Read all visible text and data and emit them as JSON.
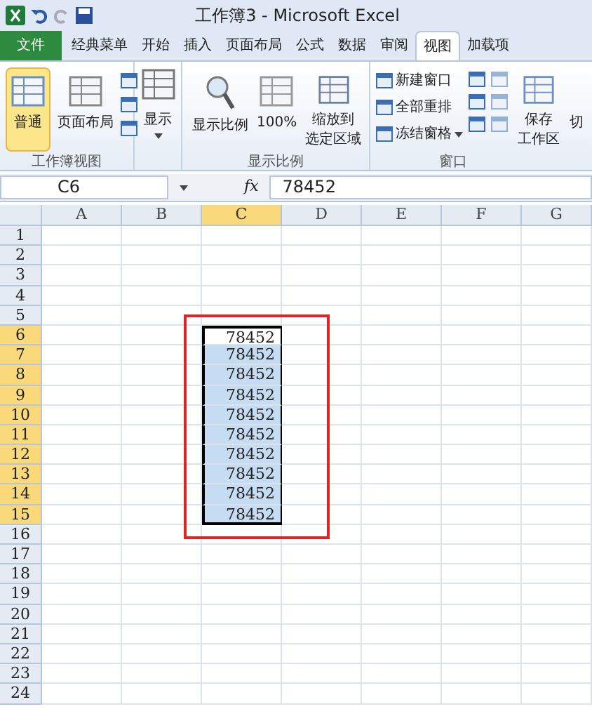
{
  "window": {
    "title": "工作簿3 - Microsoft Excel"
  },
  "tabs": [
    {
      "label": "文件",
      "kind": "file",
      "selected": false
    },
    {
      "label": "经典菜单",
      "kind": "tab",
      "selected": false
    },
    {
      "label": "开始",
      "kind": "tab",
      "selected": false
    },
    {
      "label": "插入",
      "kind": "tab",
      "selected": false
    },
    {
      "label": "页面布局",
      "kind": "tab",
      "selected": false
    },
    {
      "label": "公式",
      "kind": "tab",
      "selected": false
    },
    {
      "label": "数据",
      "kind": "tab",
      "selected": false
    },
    {
      "label": "审阅",
      "kind": "tab",
      "selected": false
    },
    {
      "label": "视图",
      "kind": "tab",
      "selected": true
    },
    {
      "label": "加载项",
      "kind": "tab",
      "selected": false
    }
  ],
  "ribbon": {
    "workbook_views": {
      "label": "工作簿视图",
      "normal": {
        "label": "普通",
        "selected": true
      },
      "page_layout": {
        "label": "页面布局",
        "selected": false
      }
    },
    "show": {
      "label": "显示"
    },
    "zoom": {
      "label": "显示比例",
      "zoom": "显示比例",
      "hundred": "100%",
      "zoom_selection": [
        "缩放到",
        "选定区域"
      ]
    },
    "window": {
      "label": "窗口",
      "new_window": "新建窗口",
      "arrange_all": "全部重排",
      "freeze_panes": "冻结窗格",
      "save_workspace": [
        "保存",
        "工作区"
      ],
      "switch_cut": "切"
    }
  },
  "formula_bar": {
    "name_box": "C6",
    "fx": "fx",
    "value": "78452"
  },
  "columns": [
    {
      "label": "A",
      "selected": false
    },
    {
      "label": "B",
      "selected": false
    },
    {
      "label": "C",
      "selected": true
    },
    {
      "label": "D",
      "selected": false
    },
    {
      "label": "E",
      "selected": false
    },
    {
      "label": "F",
      "selected": false
    },
    {
      "label": "G",
      "selected": false
    }
  ],
  "rows": [
    {
      "label": "1",
      "selected": false
    },
    {
      "label": "2",
      "selected": false
    },
    {
      "label": "3",
      "selected": false
    },
    {
      "label": "4",
      "selected": false
    },
    {
      "label": "5",
      "selected": false
    },
    {
      "label": "6",
      "selected": true,
      "active": true,
      "value": "78452"
    },
    {
      "label": "7",
      "selected": true,
      "active": false,
      "value": "78452"
    },
    {
      "label": "8",
      "selected": true,
      "active": false,
      "value": "78452"
    },
    {
      "label": "9",
      "selected": true,
      "active": false,
      "value": "78452"
    },
    {
      "label": "10",
      "selected": true,
      "active": false,
      "value": "78452"
    },
    {
      "label": "11",
      "selected": true,
      "active": false,
      "value": "78452"
    },
    {
      "label": "12",
      "selected": true,
      "active": false,
      "value": "78452"
    },
    {
      "label": "13",
      "selected": true,
      "active": false,
      "value": "78452"
    },
    {
      "label": "14",
      "selected": true,
      "active": false,
      "value": "78452"
    },
    {
      "label": "15",
      "selected": true,
      "active": false,
      "value": "78452"
    },
    {
      "label": "16",
      "selected": false
    },
    {
      "label": "17",
      "selected": false
    },
    {
      "label": "18",
      "selected": false
    },
    {
      "label": "19",
      "selected": false
    },
    {
      "label": "20",
      "selected": false
    },
    {
      "label": "21",
      "selected": false
    },
    {
      "label": "22",
      "selected": false
    },
    {
      "label": "23",
      "selected": false
    },
    {
      "label": "24",
      "selected": false
    }
  ]
}
